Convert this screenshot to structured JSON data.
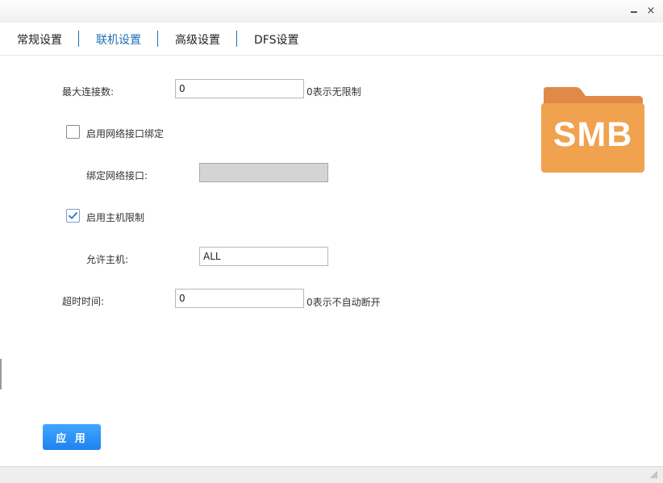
{
  "window": {
    "minimize_symbol": "",
    "close_symbol": "×"
  },
  "tabs": [
    {
      "label": "常规设置",
      "active": false
    },
    {
      "label": "联机设置",
      "active": true
    },
    {
      "label": "高级设置",
      "active": false
    },
    {
      "label": "DFS设置",
      "active": false
    }
  ],
  "form": {
    "max_connections": {
      "label": "最大连接数:",
      "value": "0",
      "hint": "0表示无限制"
    },
    "bind_interface_enable": {
      "label": "启用网络接口绑定",
      "checked": false
    },
    "bind_interface": {
      "label": "绑定网络接口:",
      "value": "",
      "disabled": true
    },
    "host_limit_enable": {
      "label": "启用主机限制",
      "checked": true
    },
    "allowed_hosts": {
      "label": "允许主机:",
      "value": "ALL"
    },
    "timeout": {
      "label": "超时时间:",
      "value": "0",
      "hint": "0表示不自动断开"
    }
  },
  "logo": {
    "text": "SMB",
    "icon": "folder-icon",
    "color_body": "#f0a24e",
    "color_tab": "#e08a48"
  },
  "apply_button": {
    "label": "应 用"
  },
  "colors": {
    "accent": "#1f6fb3",
    "button": "#2b8ff5"
  }
}
